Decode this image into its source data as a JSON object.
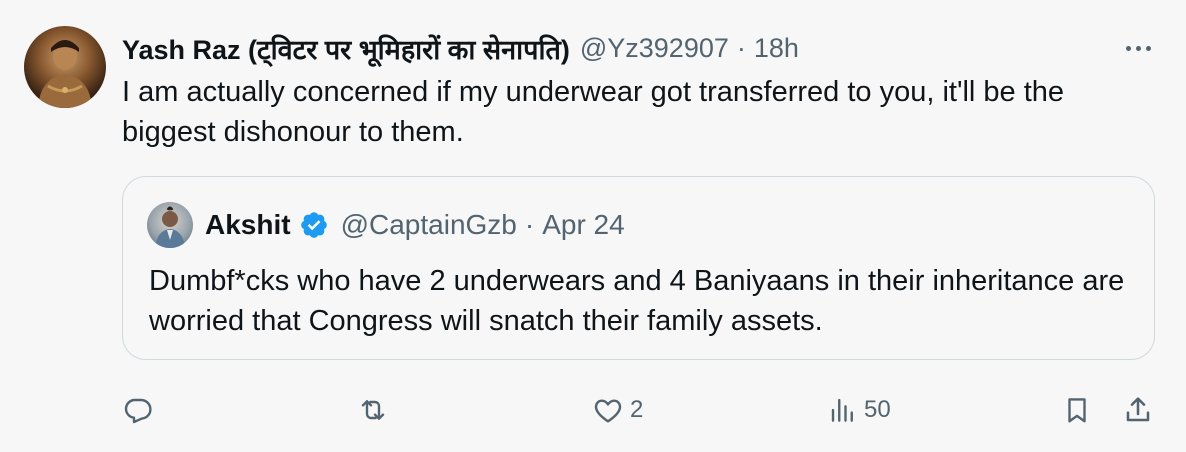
{
  "tweet": {
    "author": {
      "display_name": "Yash Raz (ट्विटर पर भूमिहारों का सेनापति)",
      "handle": "@Yz392907",
      "separator": "·",
      "time": "18h",
      "avatar_icon": "profile-avatar"
    },
    "more_icon": "more-dots-icon",
    "text": "I am actually concerned if my underwear got transferred to you, it'll be the biggest dishonour to them.",
    "quote": {
      "author": {
        "display_name": "Akshit",
        "verified": true,
        "handle": "@CaptainGzb",
        "separator": "·",
        "time": "Apr 24",
        "avatar_icon": "profile-avatar"
      },
      "text": "Dumbf*cks who have 2 underwears and 4 Baniyaans in their inheritance are worried that Congress will snatch their family assets."
    },
    "actions": {
      "reply": {
        "icon": "reply-icon",
        "count": ""
      },
      "repost": {
        "icon": "repost-icon",
        "count": ""
      },
      "like": {
        "icon": "heart-icon",
        "count": "2"
      },
      "views": {
        "icon": "views-icon",
        "count": "50"
      },
      "bookmark": {
        "icon": "bookmark-icon"
      },
      "share": {
        "icon": "share-icon"
      }
    },
    "colors": {
      "background": "#f7f7f7",
      "text": "#0f1419",
      "muted": "#536471",
      "border": "#cfd9de",
      "verified": "#1d9bf0"
    }
  }
}
